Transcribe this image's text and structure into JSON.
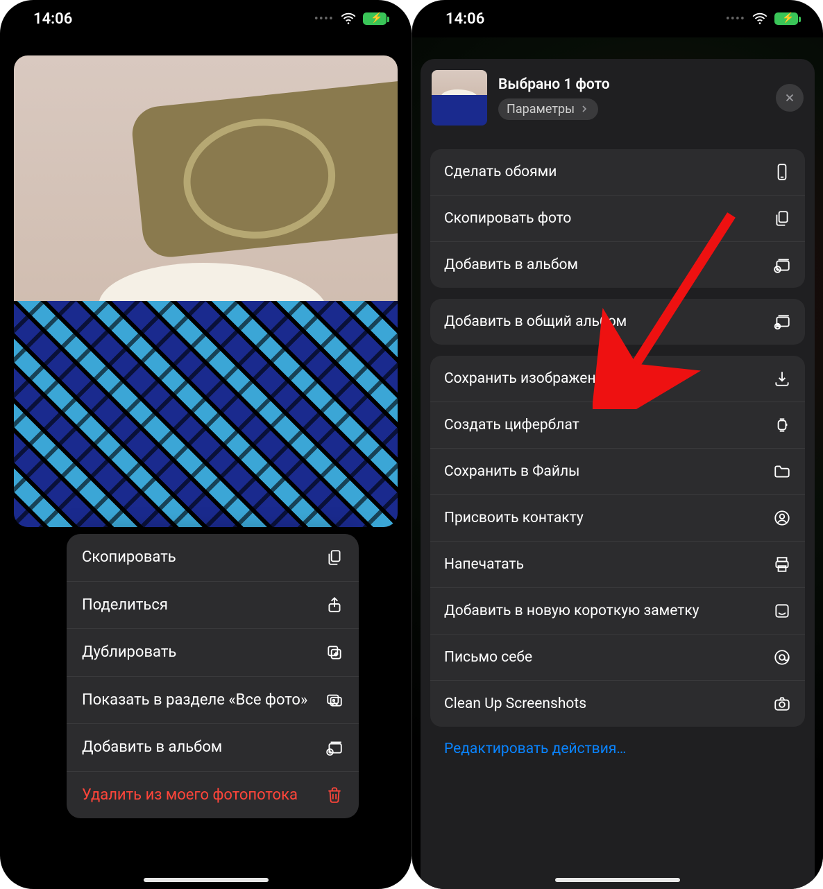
{
  "status": {
    "time": "14:06"
  },
  "left": {
    "context_menu": [
      {
        "label": "Скопировать",
        "icon": "copy-doc-icon"
      },
      {
        "label": "Поделиться",
        "icon": "share-icon"
      },
      {
        "label": "Дублировать",
        "icon": "duplicate-icon"
      },
      {
        "label": "Показать в разделе «Все фото»",
        "icon": "gallery-icon"
      },
      {
        "label": "Добавить в альбом",
        "icon": "add-album-icon"
      },
      {
        "label": "Удалить из моего фотопотока",
        "icon": "trash-icon",
        "destructive": true
      }
    ]
  },
  "right": {
    "title": "Выбрано 1 фото",
    "parameters_label": "Параметры",
    "groups": [
      [
        {
          "label": "Сделать обоями",
          "icon": "phone-icon"
        },
        {
          "label": "Скопировать фото",
          "icon": "copy-doc-icon"
        },
        {
          "label": "Добавить в альбом",
          "icon": "add-album-icon"
        }
      ],
      [
        {
          "label": "Добавить в общий альбом",
          "icon": "shared-album-icon"
        }
      ],
      [
        {
          "label": "Сохранить изображение",
          "icon": "download-icon"
        },
        {
          "label": "Создать циферблат",
          "icon": "watch-icon"
        },
        {
          "label": "Сохранить в Файлы",
          "icon": "folder-icon"
        },
        {
          "label": "Присвоить контакту",
          "icon": "contact-icon"
        },
        {
          "label": "Напечатать",
          "icon": "print-icon"
        },
        {
          "label": "Добавить в новую короткую заметку",
          "icon": "note-icon"
        },
        {
          "label": "Письмо себе",
          "icon": "at-icon"
        },
        {
          "label": "Clean Up Screenshots",
          "icon": "camera-icon"
        }
      ]
    ],
    "edit_actions": "Редактировать действия…"
  }
}
